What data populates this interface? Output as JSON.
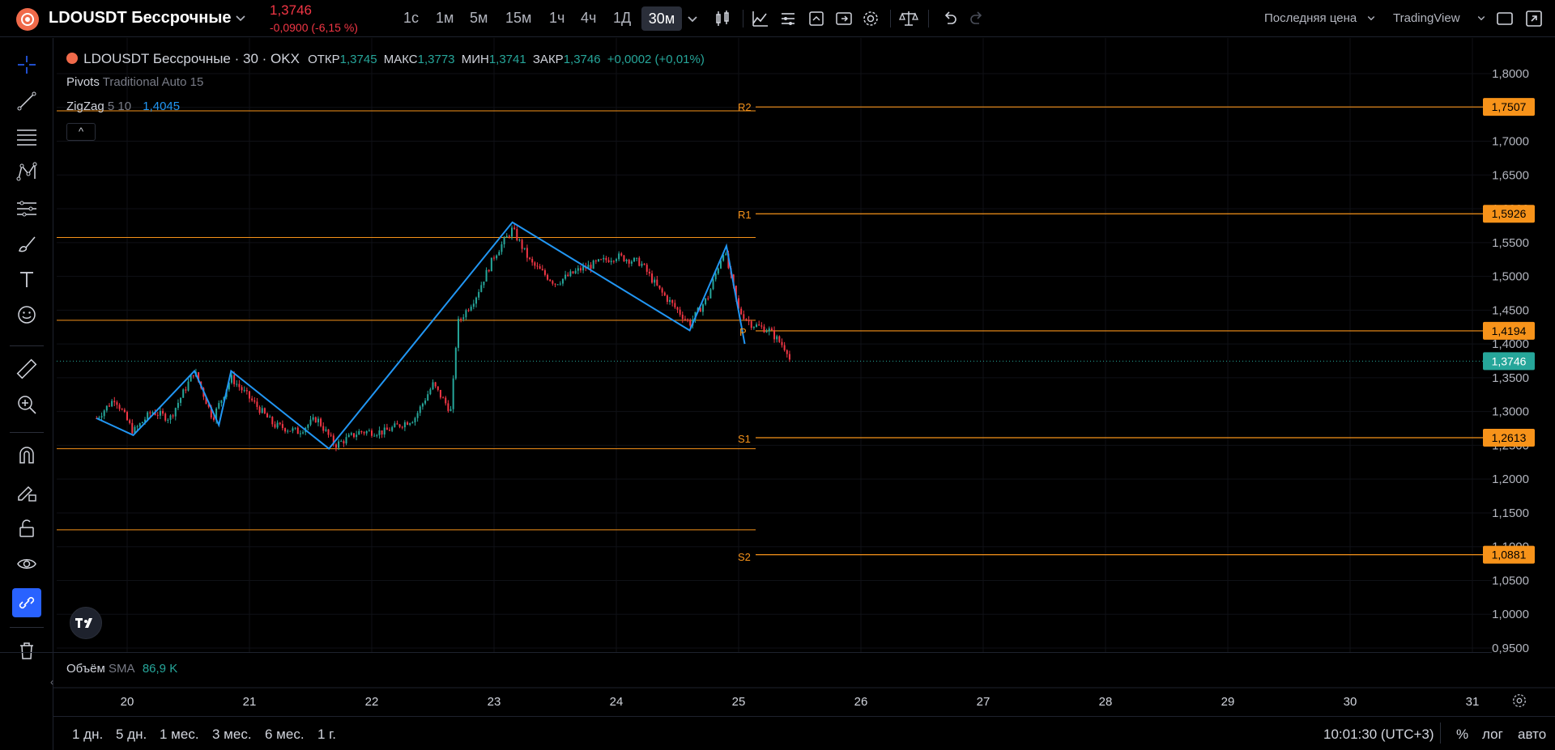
{
  "header": {
    "symbol": "LDOUSDT Бессрочные",
    "price": "1,3746",
    "change": "-0,0900 (-6,15 %)",
    "timeframes": [
      "1с",
      "1м",
      "5м",
      "15м",
      "1ч",
      "4ч",
      "1Д"
    ],
    "active_timeframe": "30м",
    "price_source": "Последняя цена",
    "brand": "TradingView"
  },
  "legend": {
    "title": "LDOUSDT Бессрочные · 30 · OKX",
    "open_label": "ОТКР",
    "open": "1,3745",
    "high_label": "МАКС",
    "high": "1,3773",
    "low_label": "МИН",
    "low": "1,3741",
    "close_label": "ЗАКР",
    "close": "1,3746",
    "change": "+0,0002 (+0,01%)",
    "pivots_name": "Pivots",
    "pivots_params": "Traditional Auto 15",
    "zigzag_name": "ZigZag",
    "zigzag_params": "5 10",
    "zigzag_value": "1,4045",
    "volume_name": "Объём",
    "volume_ma": "SMA",
    "volume_value": "86,9 K"
  },
  "pivot_labels": {
    "r2": "R2",
    "r1": "R1",
    "p": "P",
    "s1": "S1",
    "s2": "S2"
  },
  "price_badges": {
    "r2": "1,7507",
    "r1": "1,5926",
    "p": "1,4194",
    "last": "1,3746",
    "s1": "1,2613",
    "s2": "1,0881"
  },
  "chart_data": {
    "type": "candlestick",
    "y_axis_ticks": [
      "1,8000",
      "1,7500",
      "1,7000",
      "1,6500",
      "1,6000",
      "1,5500",
      "1,5000",
      "1,4500",
      "1,4000",
      "1,3500",
      "1,3000",
      "1,2500",
      "1,2000",
      "1,1500",
      "1,1000",
      "1,0500",
      "1,0000",
      "0,9500"
    ],
    "x_axis_ticks": [
      "20",
      "21",
      "22",
      "23",
      "24",
      "25",
      "26",
      "27",
      "28",
      "29",
      "30",
      "31"
    ],
    "ylim": [
      0.95,
      1.8
    ],
    "pivot_levels": {
      "R2": 1.7507,
      "R1": 1.5926,
      "P": 1.4194,
      "S1": 1.2613,
      "S2": 1.0881
    },
    "last_price": 1.3746,
    "zigzag": [
      [
        19.75,
        1.29
      ],
      [
        20.05,
        1.265
      ],
      [
        20.55,
        1.36
      ],
      [
        20.75,
        1.28
      ],
      [
        20.85,
        1.36
      ],
      [
        21.65,
        1.245
      ],
      [
        23.15,
        1.58
      ],
      [
        24.6,
        1.42
      ],
      [
        24.9,
        1.545
      ],
      [
        25.05,
        1.4
      ]
    ],
    "series": [
      {
        "name": "price",
        "values": [
          [
            19.75,
            1.29
          ],
          [
            19.9,
            1.32
          ],
          [
            20.05,
            1.27
          ],
          [
            20.2,
            1.3
          ],
          [
            20.35,
            1.29
          ],
          [
            20.55,
            1.36
          ],
          [
            20.7,
            1.29
          ],
          [
            20.85,
            1.35
          ],
          [
            21.0,
            1.32
          ],
          [
            21.2,
            1.28
          ],
          [
            21.4,
            1.27
          ],
          [
            21.55,
            1.29
          ],
          [
            21.7,
            1.25
          ],
          [
            21.9,
            1.27
          ],
          [
            22.1,
            1.27
          ],
          [
            22.35,
            1.29
          ],
          [
            22.5,
            1.34
          ],
          [
            22.65,
            1.3
          ],
          [
            22.7,
            1.43
          ],
          [
            22.85,
            1.47
          ],
          [
            23.0,
            1.53
          ],
          [
            23.15,
            1.57
          ],
          [
            23.3,
            1.52
          ],
          [
            23.5,
            1.49
          ],
          [
            23.7,
            1.51
          ],
          [
            23.85,
            1.52
          ],
          [
            24.0,
            1.53
          ],
          [
            24.2,
            1.52
          ],
          [
            24.35,
            1.48
          ],
          [
            24.6,
            1.43
          ],
          [
            24.75,
            1.47
          ],
          [
            24.88,
            1.54
          ],
          [
            25.0,
            1.45
          ],
          [
            25.1,
            1.43
          ],
          [
            25.25,
            1.42
          ],
          [
            25.4,
            1.39
          ],
          [
            25.42,
            1.3746
          ]
        ]
      }
    ],
    "pivot_history": [
      {
        "R1_prev": 1.5575,
        "P_prev": 1.435,
        "S1_prev": 1.245,
        "S2_prev": 1.125
      }
    ]
  },
  "bottom": {
    "ranges": [
      "1 дн.",
      "5 дн.",
      "1 мес.",
      "3 мес.",
      "6 мес.",
      "1 г."
    ],
    "time": "10:01:30 (UTC+3)",
    "percent": "%",
    "log": "лог",
    "auto": "авто"
  },
  "colors": {
    "up": "#26a69a",
    "down": "#f23645",
    "pivot": "#f7931a",
    "zigzag": "#2196f3"
  }
}
